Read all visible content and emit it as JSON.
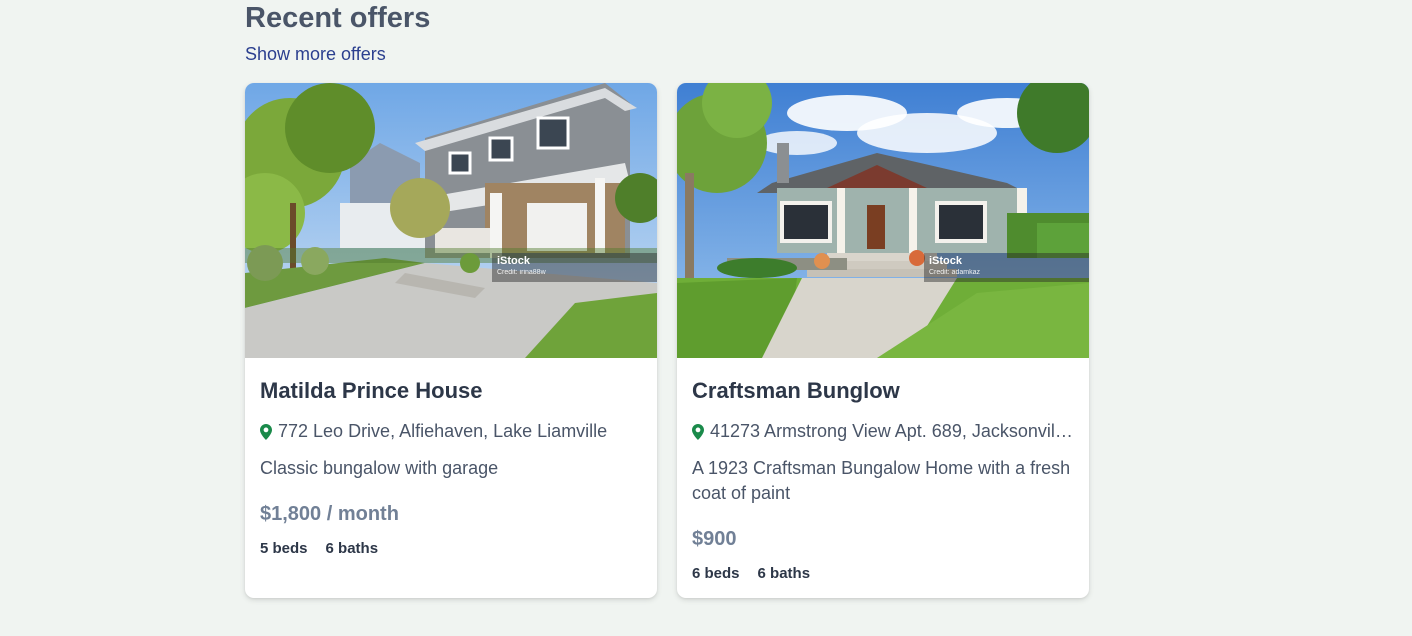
{
  "section": {
    "title": "Recent offers",
    "show_more_label": "Show more offers"
  },
  "colors": {
    "background": "#f0f4f1",
    "title": "#4a5568",
    "link": "#2b3f8f",
    "pin": "#1a8a4a",
    "price": "#718096"
  },
  "listings": [
    {
      "title": "Matilda Prince House",
      "address": "772 Leo Drive, Alfiehaven, Lake Liamville",
      "description": "Classic bungalow with garage",
      "price": "$1,800 / month",
      "beds": "5 beds",
      "baths": "6 baths",
      "image_icon": "house-photo",
      "watermark": {
        "brand": "iStock",
        "credit": "Credit: irina88w"
      }
    },
    {
      "title": "Craftsman Bunglow",
      "address": "41273 Armstrong View Apt. 689, Jacksonville...",
      "description": "A 1923 Craftsman Bungalow Home with a fresh coat of paint",
      "price": "$900",
      "beds": "6 beds",
      "baths": "6 baths",
      "image_icon": "house-photo",
      "watermark": {
        "brand": "iStock",
        "credit": "Credit: adamkaz"
      }
    }
  ]
}
